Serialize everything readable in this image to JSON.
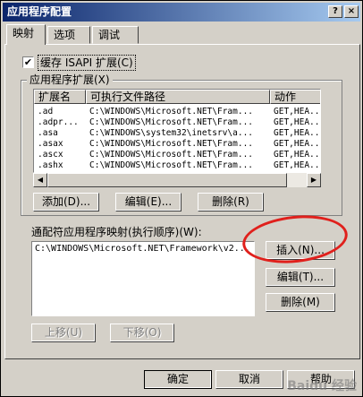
{
  "window": {
    "title": "应用程序配置",
    "help_btn": "?",
    "close_btn": "×"
  },
  "tabs": [
    {
      "label": "映射",
      "active": true
    },
    {
      "label": "选项",
      "active": false
    },
    {
      "label": "调试",
      "active": false
    }
  ],
  "cache_isapi": {
    "label": "缓存 ISAPI 扩展(C)",
    "checked": true,
    "check_glyph": "✔"
  },
  "app_ext_group": {
    "label": "应用程序扩展(X)",
    "columns": [
      "扩展名",
      "可执行文件路径",
      "动作"
    ],
    "rows": [
      [
        ".ad",
        "C:\\WINDOWS\\Microsoft.NET\\Fram...",
        "GET,HEA..."
      ],
      [
        ".adpr...",
        "C:\\WINDOWS\\Microsoft.NET\\Fram...",
        "GET,HEA..."
      ],
      [
        ".asa",
        "C:\\WINDOWS\\system32\\inetsrv\\a...",
        "GET,HEA..."
      ],
      [
        ".asax",
        "C:\\WINDOWS\\Microsoft.NET\\Fram...",
        "GET,HEA..."
      ],
      [
        ".ascx",
        "C:\\WINDOWS\\Microsoft.NET\\Fram...",
        "GET,HEA..."
      ],
      [
        ".ashx",
        "C:\\WINDOWS\\Microsoft.NET\\Fram...",
        "GET,HEA..."
      ]
    ],
    "buttons": {
      "add": "添加(D)...",
      "edit": "编辑(E)...",
      "remove": "删除(R)"
    }
  },
  "wildcard": {
    "label": "通配符应用程序映射(执行顺序)(W):",
    "items": [
      "C:\\WINDOWS\\Microsoft.NET\\Framework\\v2..."
    ],
    "buttons": {
      "insert": "插入(N)...",
      "edit": "编辑(T)...",
      "remove": "删除(M)",
      "move_up": "上移(U)",
      "move_down": "下移(O)"
    }
  },
  "footer": {
    "ok": "确定",
    "cancel": "取消",
    "help": "帮助"
  },
  "scroll_glyphs": {
    "up": "▲",
    "down": "▼",
    "left": "◀",
    "right": "▶"
  },
  "watermark": "Baidu 经验"
}
